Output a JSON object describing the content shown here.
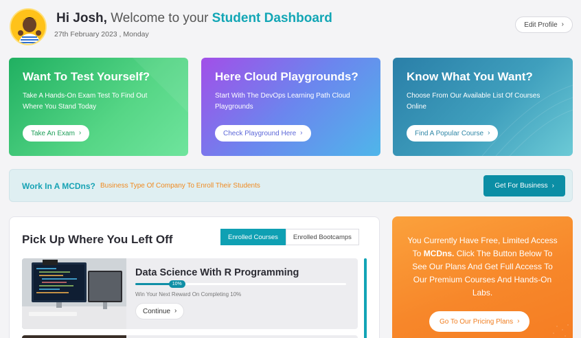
{
  "header": {
    "greeting": "Hi Josh,",
    "welcome_text": "Welcome to your",
    "dashboard_text": "Student Dashboard",
    "date": "27th February 2023 , Monday",
    "edit_profile_label": "Edit Profile"
  },
  "cards": [
    {
      "title": "Want To Test Yourself?",
      "description": "Take A Hands-On Exam Test To Find Out Where You Stand Today",
      "button_label": "Take An Exam"
    },
    {
      "title": "Here Cloud Playgrounds?",
      "description": "Start With The DevOps Learning Path Cloud Playgrounds",
      "button_label": "Check Playground Here"
    },
    {
      "title": "Know What You Want?",
      "description": "Choose From Our Available List Of Courses Online",
      "button_label": "Find A Popular Course"
    }
  ],
  "business_banner": {
    "title": "Work In A MCDns?",
    "subtitle": "Business Type Of Company To Enroll Their Students",
    "button_label": "Get For Business"
  },
  "continue_panel": {
    "title": "Pick Up Where You Left Off",
    "tabs": [
      "Enrolled Courses",
      "Enrolled Bootcamps"
    ],
    "active_tab": "Enrolled Courses",
    "course": {
      "title": "Data Science With R Programming",
      "progress_percent": 10,
      "progress_label": "10%",
      "reward_text": "Win Your Next Reward On Completing 10%",
      "button_label": "Continue"
    }
  },
  "promo": {
    "text_before": "You Currently Have Free,  Limited Access To",
    "brand": "MCDns.",
    "text_after": "Click The Button Below To See Our Plans And Get Full Access To Our Premium  Courses And Hands-On Labs.",
    "button_label": "Go To Our Pricing Plans"
  },
  "colors": {
    "accent": "#12a6b5",
    "orange": "#f7872a",
    "business_button": "#0b8ea5"
  }
}
